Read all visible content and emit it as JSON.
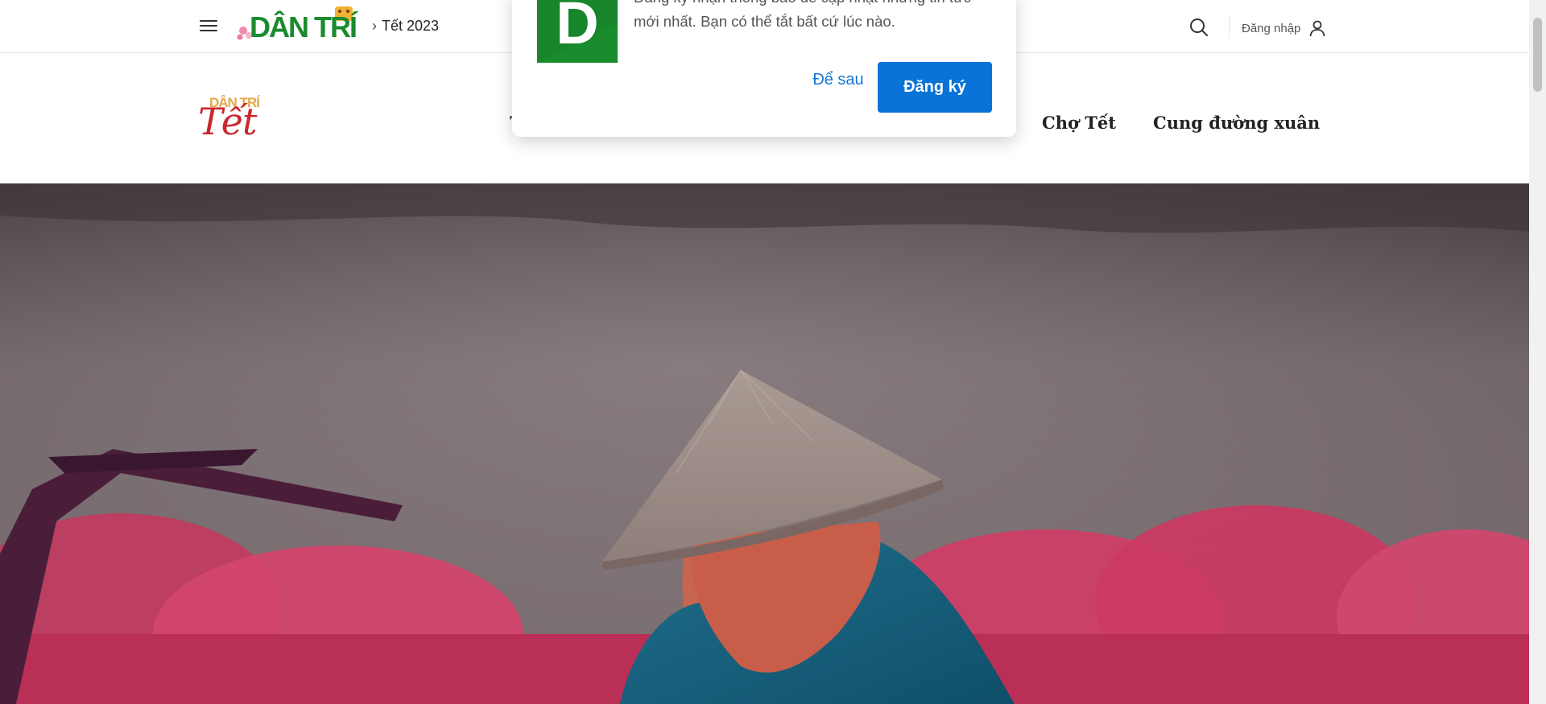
{
  "topbar": {
    "breadcrumb": "Tết 2023",
    "login_label": "Đăng nhập"
  },
  "logo": {
    "brand_small": "DÂN TRÍ",
    "tet_brand": "DÂN TRÍ",
    "tet_word": "Tết"
  },
  "nav": {
    "partial_left": "T",
    "items": [
      "Chợ Tết",
      "Cung đường xuân"
    ]
  },
  "popup": {
    "logo_letter": "D",
    "message": "Đăng ký nhận thông báo để cập nhật những tin tức mới nhất. Bạn có thể tắt bất cứ lúc nào.",
    "later_label": "Để sau",
    "subscribe_label": "Đăng ký"
  },
  "colors": {
    "brand_green": "#1a8c2e",
    "tet_red": "#c9282d",
    "button_blue": "#0a73d8"
  },
  "icons": [
    "menu-icon",
    "search-icon",
    "user-icon"
  ]
}
